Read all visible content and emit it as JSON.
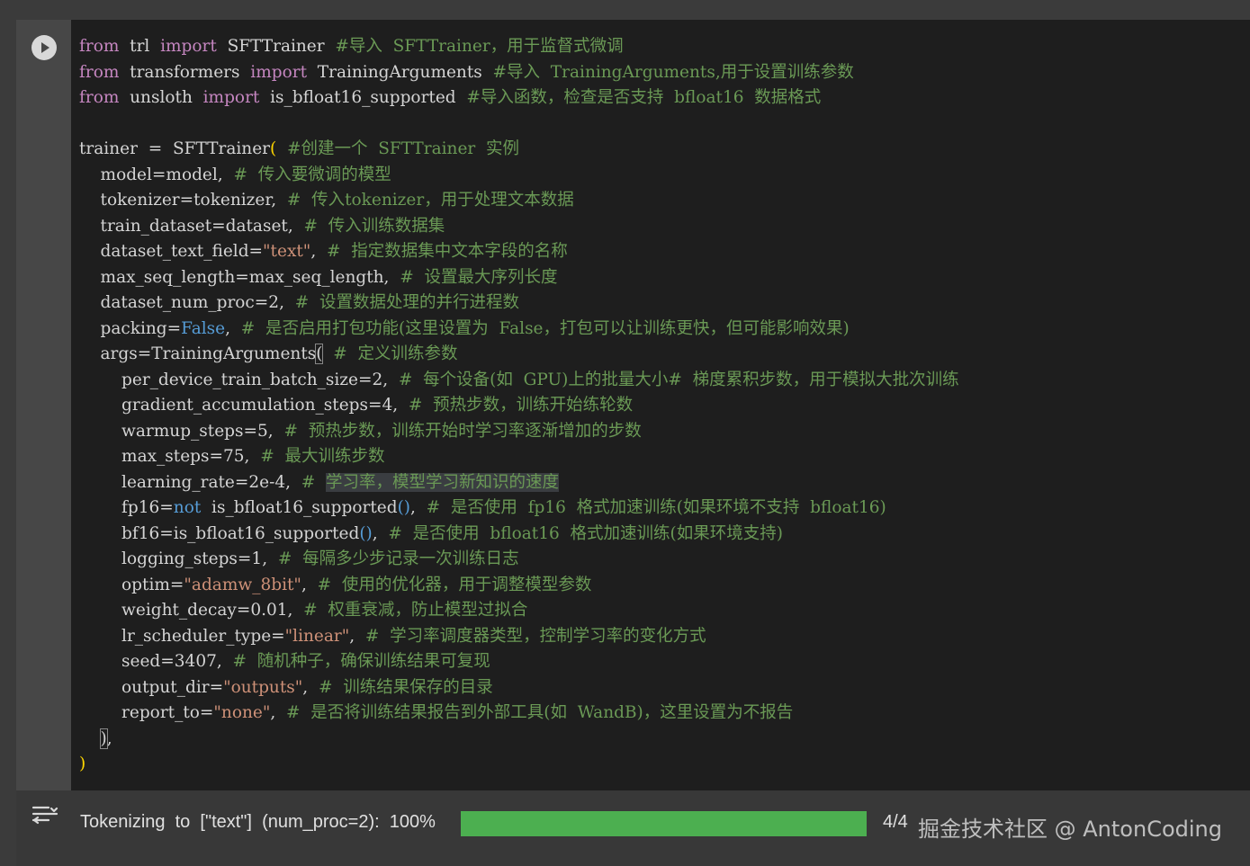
{
  "code_lines": [
    [
      [
        "kw",
        "from"
      ],
      [
        "",
        "  trl  "
      ],
      [
        "kw",
        "import"
      ],
      [
        "",
        "  SFTTrainer  "
      ],
      [
        "cm",
        "#导入  SFTTrainer，用于监督式微调"
      ]
    ],
    [
      [
        "kw",
        "from"
      ],
      [
        "",
        "  transformers  "
      ],
      [
        "kw",
        "import"
      ],
      [
        "",
        "  TrainingArguments  "
      ],
      [
        "cm",
        "#导入  TrainingArguments,用于设置训练参数"
      ]
    ],
    [
      [
        "kw",
        "from"
      ],
      [
        "",
        "  unsloth  "
      ],
      [
        "kw",
        "import"
      ],
      [
        "",
        "  is_bfloat16_supported  "
      ],
      [
        "cm",
        "#导入函数，检查是否支持  bfloat16  数据格式"
      ]
    ],
    [],
    [
      [
        "",
        "trainer  =  SFTTrainer"
      ],
      [
        "br",
        "("
      ],
      [
        "",
        "  "
      ],
      [
        "cm",
        "#创建一个  SFTTrainer  实例"
      ]
    ],
    [
      [
        "",
        "    model=model,  "
      ],
      [
        "cm",
        "#  传入要微调的模型"
      ]
    ],
    [
      [
        "",
        "    tokenizer=tokenizer,  "
      ],
      [
        "cm",
        "#  传入tokenizer，用于处理文本数据"
      ]
    ],
    [
      [
        "",
        "    train_dataset=dataset,  "
      ],
      [
        "cm",
        "#  传入训练数据集"
      ]
    ],
    [
      [
        "",
        "    dataset_text_field="
      ],
      [
        "st",
        "\"text\""
      ],
      [
        "",
        ",  "
      ],
      [
        "cm",
        "#  指定数据集中文本字段的名称"
      ]
    ],
    [
      [
        "",
        "    max_seq_length=max_seq_length,  "
      ],
      [
        "cm",
        "#  设置最大序列长度"
      ]
    ],
    [
      [
        "",
        "    dataset_num_proc=2,  "
      ],
      [
        "cm",
        "#  设置数据处理的并行进程数"
      ]
    ],
    [
      [
        "",
        "    packing="
      ],
      [
        "bl",
        "False"
      ],
      [
        "",
        ",  "
      ],
      [
        "cm",
        "#  是否启用打包功能(这里设置为  False，打包可以让训练更快，但可能影响效果)"
      ]
    ],
    [
      [
        "",
        "    args=TrainingArguments"
      ],
      [
        "brbox",
        "("
      ],
      [
        "",
        "  "
      ],
      [
        "cm",
        "#  定义训练参数"
      ]
    ],
    [
      [
        "",
        "        per_device_train_batch_size=2,  "
      ],
      [
        "cm",
        "#  每个设备(如  GPU)上的批量大小#  梯度累积步数，用于模拟大批次训练"
      ]
    ],
    [
      [
        "",
        "        gradient_accumulation_steps=4,  "
      ],
      [
        "cm",
        "#  预热步数，训练开始练轮数"
      ]
    ],
    [
      [
        "",
        "        warmup_steps=5,  "
      ],
      [
        "cm",
        "#  预热步数，训练开始时学习率逐渐增加的步数"
      ]
    ],
    [
      [
        "",
        "        max_steps=75,  "
      ],
      [
        "cm",
        "#  最大训练步数"
      ]
    ],
    [
      [
        "",
        "        learning_rate=2e-4,  "
      ],
      [
        "cm",
        "#  "
      ],
      [
        "hlcm",
        "学习率，模型学习新知识的速度"
      ]
    ],
    [
      [
        "",
        "        fp16="
      ],
      [
        "bl",
        "not"
      ],
      [
        "",
        "  is_bfloat16_supported"
      ],
      [
        "bl",
        "()"
      ],
      [
        "",
        ",  "
      ],
      [
        "cm",
        "#  是否使用  fp16  格式加速训练(如果环境不支持  bfloat16)"
      ]
    ],
    [
      [
        "",
        "        bf16=is_bfloat16_supported"
      ],
      [
        "bl",
        "()"
      ],
      [
        "",
        ",  "
      ],
      [
        "cm",
        "#  是否使用  bfloat16  格式加速训练(如果环境支持)"
      ]
    ],
    [
      [
        "",
        "        logging_steps=1,  "
      ],
      [
        "cm",
        "#  每隔多少步记录一次训练日志"
      ]
    ],
    [
      [
        "",
        "        optim="
      ],
      [
        "st",
        "\"adamw_8bit\""
      ],
      [
        "",
        ",  "
      ],
      [
        "cm",
        "#  使用的优化器，用于调整模型参数"
      ]
    ],
    [
      [
        "",
        "        weight_decay=0.01,  "
      ],
      [
        "cm",
        "#  权重衰减，防止模型过拟合"
      ]
    ],
    [
      [
        "",
        "        lr_scheduler_type="
      ],
      [
        "st",
        "\"linear\""
      ],
      [
        "",
        ",  "
      ],
      [
        "cm",
        "#  学习率调度器类型，控制学习率的变化方式"
      ]
    ],
    [
      [
        "",
        "        seed=3407,  "
      ],
      [
        "cm",
        "#  随机种子，确保训练结果可复现"
      ]
    ],
    [
      [
        "",
        "        output_dir="
      ],
      [
        "st",
        "\"outputs\""
      ],
      [
        "",
        ",  "
      ],
      [
        "cm",
        "#  训练结果保存的目录"
      ]
    ],
    [
      [
        "",
        "        report_to="
      ],
      [
        "st",
        "\"none\""
      ],
      [
        "",
        ",  "
      ],
      [
        "cm",
        "#  是否将训练结果报告到外部工具(如  WandB)，这里设置为不报告"
      ]
    ],
    [
      [
        "",
        "    "
      ],
      [
        "brbox",
        ")"
      ],
      [
        "",
        ","
      ]
    ],
    [
      [
        "br",
        ")"
      ]
    ]
  ],
  "output": {
    "label": "Tokenizing  to  [\"text\"]  (num_proc=2):  100%",
    "progress_fraction": 1.0,
    "count": "4/4",
    "watermark": "掘金技术社区 @ AntonCoding",
    "bar_color": "#4caf50"
  },
  "icons": {
    "run": "play-circle-icon",
    "output": "output-toggle-icon"
  }
}
